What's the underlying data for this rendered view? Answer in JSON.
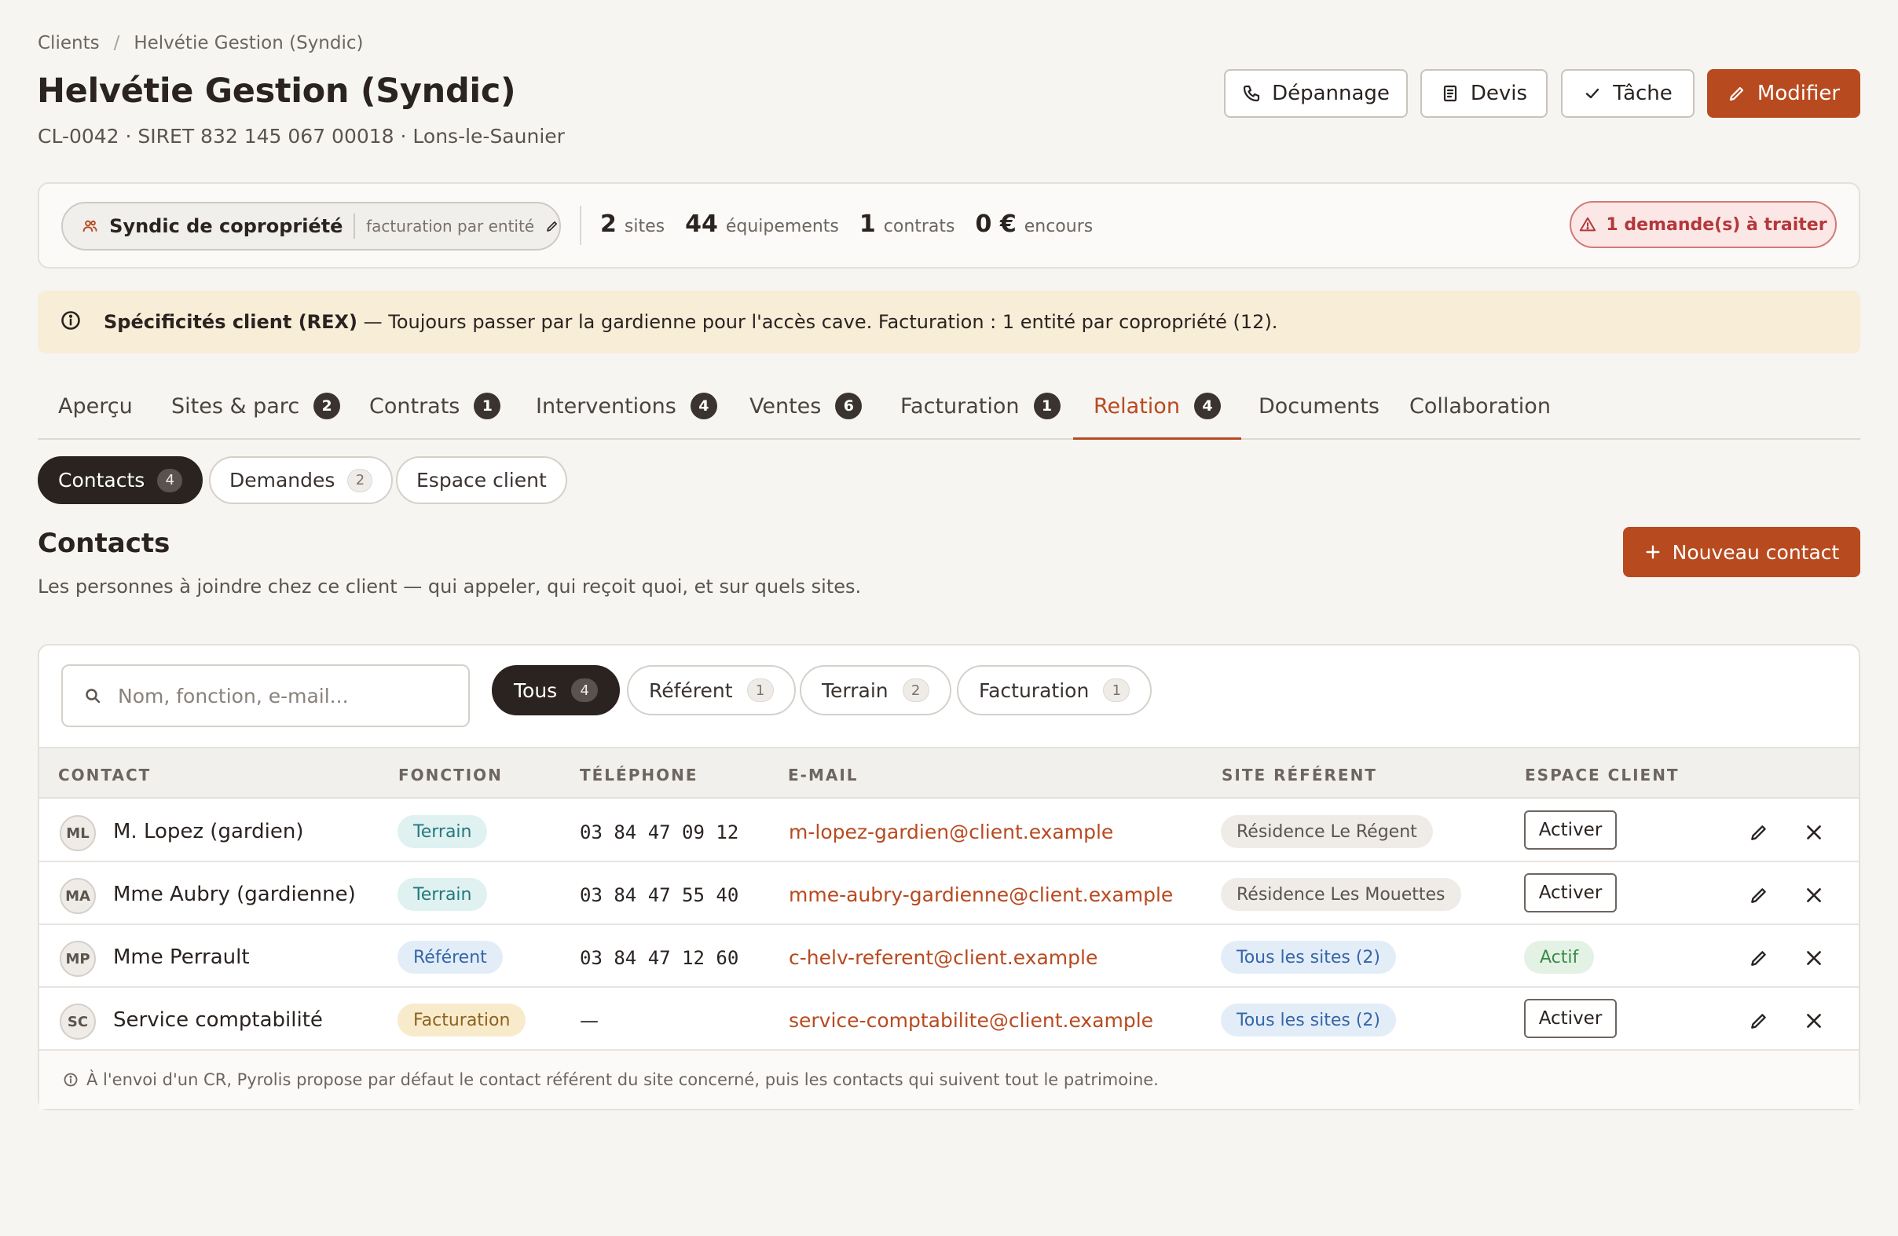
{
  "breadcrumb": {
    "root": "Clients",
    "separator": "/",
    "current": "Helvétie Gestion (Syndic)"
  },
  "page": {
    "title": "Helvétie Gestion (Syndic)",
    "subtitle": "CL-0042 · SIRET 832 145 067 00018 · Lons-le-Saunier"
  },
  "actions": {
    "depannage": "Dépannage",
    "devis": "Devis",
    "tache": "Tâche",
    "modifier": "Modifier"
  },
  "summary": {
    "client_type": "Syndic de copropriété",
    "billing_mode": "facturation par entité",
    "stats": [
      {
        "value": "2",
        "label": "sites"
      },
      {
        "value": "44",
        "label": "équipements"
      },
      {
        "value": "1",
        "label": "contrats"
      },
      {
        "value": "0 €",
        "label": "encours"
      }
    ],
    "alert": "1 demande(s) à traiter"
  },
  "rex": {
    "title": "Spécificités client (REX)",
    "text": " — Toujours passer par la gardienne pour l'accès cave. Facturation : 1 entité par copropriété (12)."
  },
  "tabs": [
    {
      "label": "Aperçu",
      "count": null
    },
    {
      "label": "Sites & parc",
      "count": "2"
    },
    {
      "label": "Contrats",
      "count": "1"
    },
    {
      "label": "Interventions",
      "count": "4"
    },
    {
      "label": "Ventes",
      "count": "6"
    },
    {
      "label": "Facturation",
      "count": "1"
    },
    {
      "label": "Relation",
      "count": "4",
      "active": true
    },
    {
      "label": "Documents",
      "count": null
    },
    {
      "label": "Collaboration",
      "count": null
    }
  ],
  "subtabs": [
    {
      "label": "Contacts",
      "count": "4",
      "active": true
    },
    {
      "label": "Demandes",
      "count": "2"
    },
    {
      "label": "Espace client",
      "count": null
    }
  ],
  "contacts_section": {
    "title": "Contacts",
    "description": "Les personnes à joindre chez ce client — qui appeler, qui reçoit quoi, et sur quels sites.",
    "new_button": "Nouveau contact"
  },
  "search": {
    "placeholder": "Nom, fonction, e-mail...",
    "value": ""
  },
  "filters": [
    {
      "label": "Tous",
      "count": "4",
      "active": true
    },
    {
      "label": "Référent",
      "count": "1"
    },
    {
      "label": "Terrain",
      "count": "2"
    },
    {
      "label": "Facturation",
      "count": "1"
    }
  ],
  "table": {
    "columns": [
      "CONTACT",
      "FONCTION",
      "TÉLÉPHONE",
      "E-MAIL",
      "SITE RÉFÉRENT",
      "ESPACE CLIENT"
    ],
    "rows": [
      {
        "initials": "ML",
        "name": "M. Lopez (gardien)",
        "role": "Terrain",
        "phone": "03 84 47 09 12",
        "email": "m-lopez-gardien@client.example",
        "site": "Résidence Le Régent",
        "portal": "Activer"
      },
      {
        "initials": "MA",
        "name": "Mme Aubry (gardienne)",
        "role": "Terrain",
        "phone": "03 84 47 55 40",
        "email": "mme-aubry-gardienne@client.example",
        "site": "Résidence Les Mouettes",
        "portal": "Activer"
      },
      {
        "initials": "MP",
        "name": "Mme Perrault",
        "role": "Référent",
        "phone": "03 84 47 12 60",
        "email": "c-helv-referent@client.example",
        "site": "Tous les sites (2)",
        "portal": "Actif"
      },
      {
        "initials": "SC",
        "name": "Service comptabilité",
        "role": "Facturation",
        "phone": "—",
        "email": "service-comptabilite@client.example",
        "site": "Tous les sites (2)",
        "portal": "Activer"
      }
    ],
    "footnote": "À l'envoi d'un CR, Pyrolis propose par défaut le contact référent du site concerné, puis les contacts qui suivent tout le patrimoine."
  },
  "colors": {
    "accent": "#b84a1f",
    "dark": "#2a2320",
    "alert": "#b3383a",
    "banner": "#f8edd7"
  }
}
